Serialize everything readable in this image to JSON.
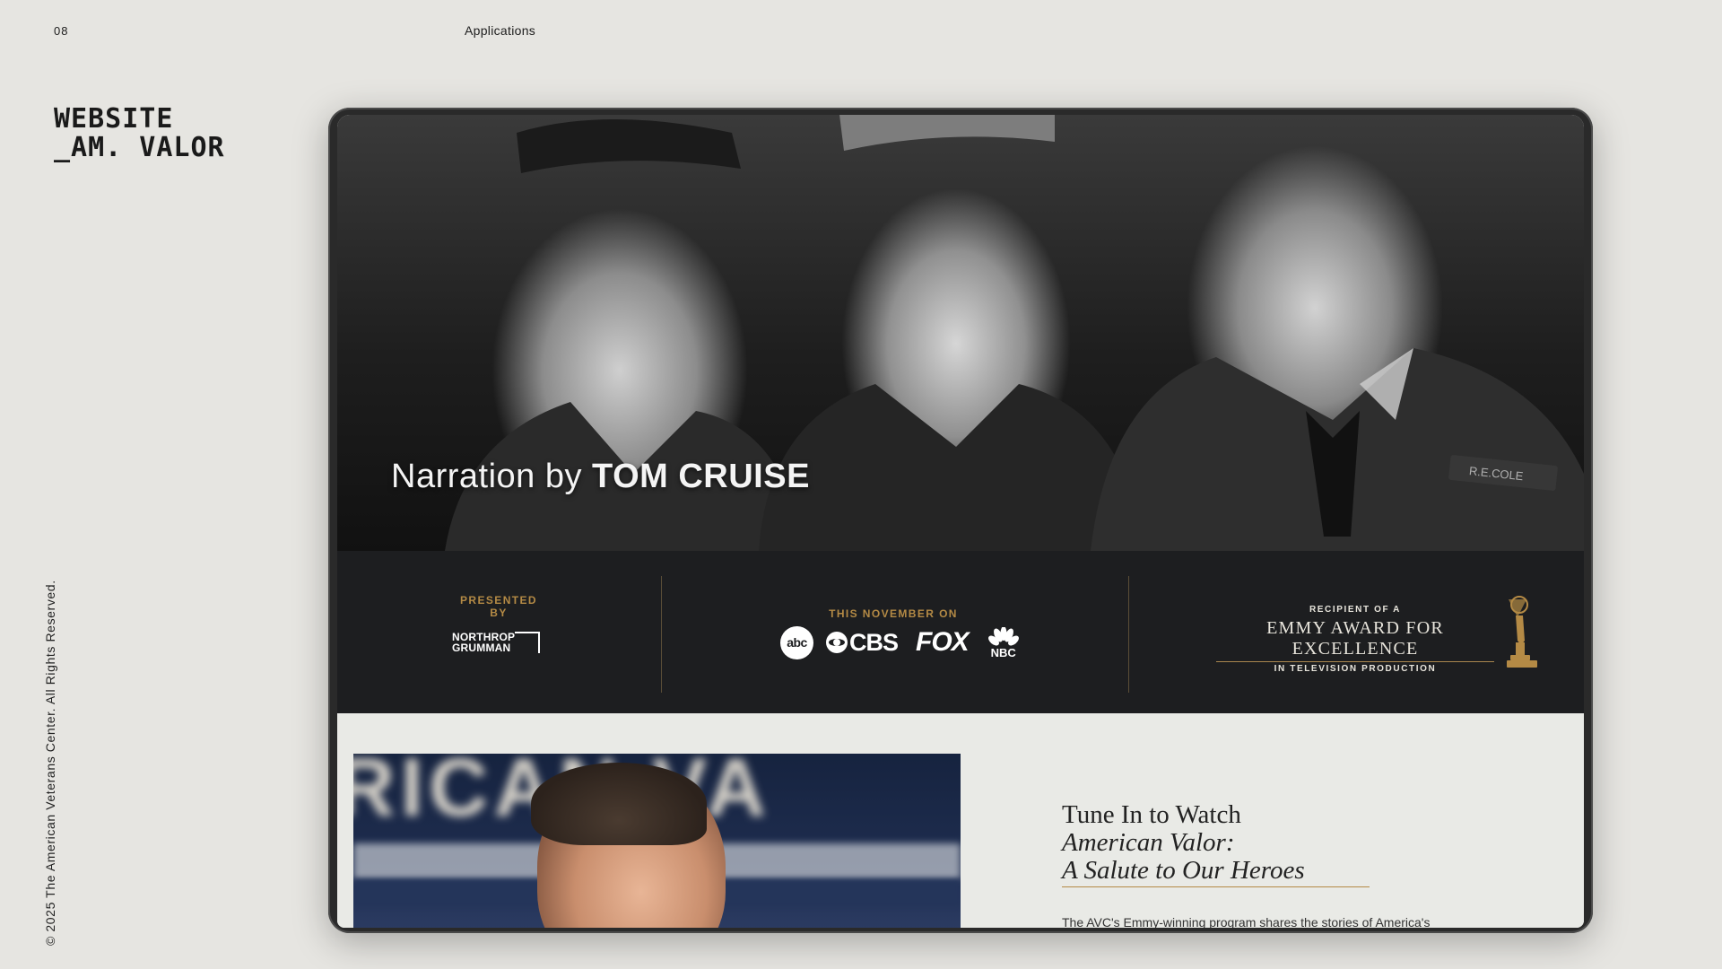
{
  "page": {
    "number": "08",
    "section": "Applications",
    "brand_line1": "WEBSITE",
    "brand_line2": "_AM. VALOR",
    "copyright": "© 2025 The American Veterans Center. All Rights Reserved."
  },
  "hero": {
    "caption_prefix": "Narration by",
    "caption_name": "TOM CRUISE",
    "name_tag": "R.E.COLE"
  },
  "infobar": {
    "presented_label": "PRESENTED BY",
    "sponsor_line1": "NORTHROP",
    "sponsor_line2": "GRUMMAN",
    "airing_label": "THIS NOVEMBER ON",
    "networks": {
      "abc": "abc",
      "cbs": "CBS",
      "fox": "FOX",
      "nbc": "NBC"
    },
    "emmy_top": "RECIPIENT OF A",
    "emmy_main": "EMMY AWARD FOR EXCELLENCE",
    "emmy_sub": "IN TELEVISION PRODUCTION"
  },
  "promo": {
    "bg_letters": "RICAN VA",
    "title_line1": "Tune In to Watch",
    "title_line2": "American Valor:",
    "title_line3": "A Salute to Our Heroes",
    "body": "The AVC's Emmy-winning program shares the stories of America's"
  },
  "colors": {
    "page_bg": "#e6e5e1",
    "bar_bg": "#1d1e20",
    "gold": "#b48a45"
  }
}
